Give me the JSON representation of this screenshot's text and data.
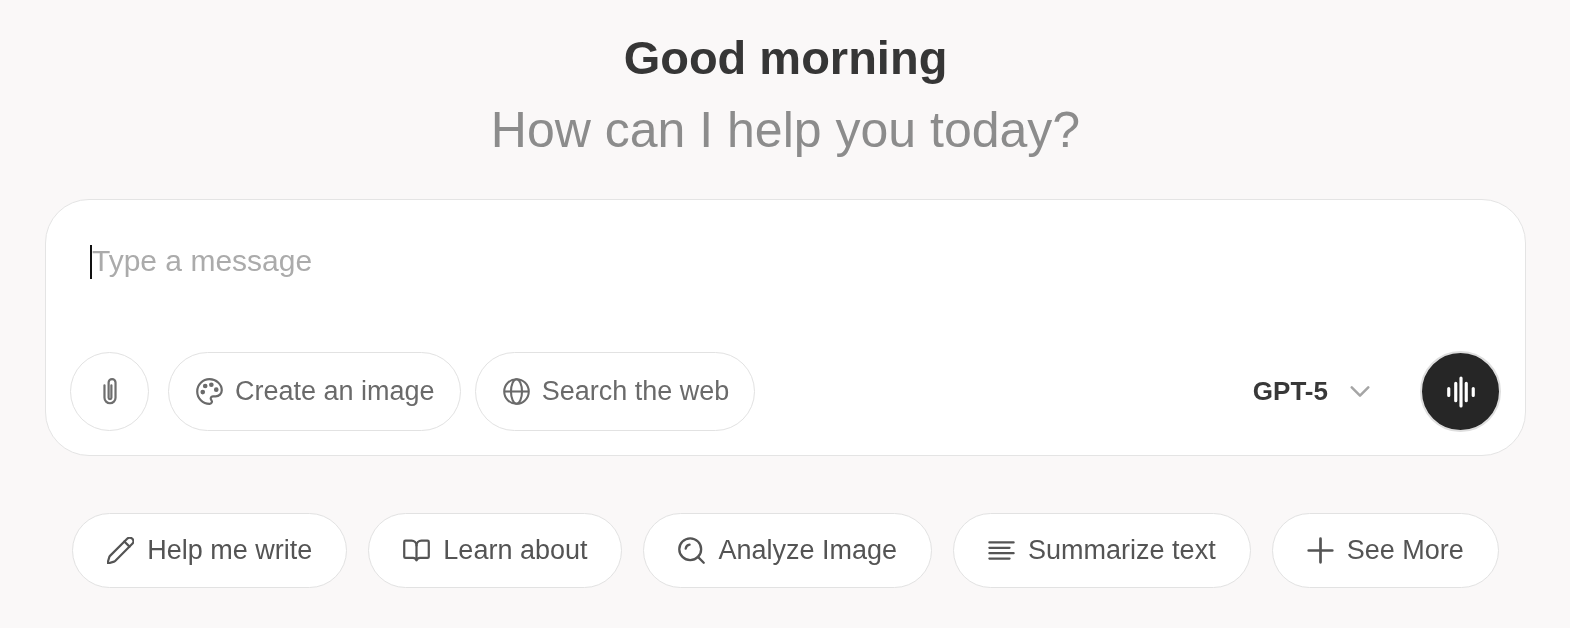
{
  "greeting": {
    "title": "Good morning",
    "subtitle": "How can I help you today?"
  },
  "composer": {
    "placeholder": "Type a message",
    "focused": true,
    "tools": [
      "Create an image",
      "Search the web"
    ],
    "model": "GPT-5"
  },
  "suggestions": [
    "Help me write",
    "Learn about",
    "Analyze Image",
    "Summarize text",
    "See More"
  ]
}
